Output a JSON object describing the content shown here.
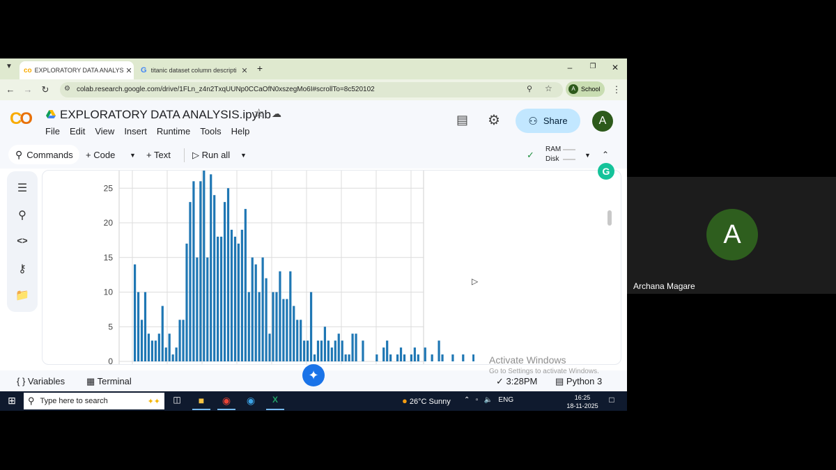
{
  "browser": {
    "tabs": [
      {
        "title": "EXPLORATORY DATA ANALYSIS",
        "icon": "colab-icon",
        "active": true
      },
      {
        "title": "titanic dataset column descripti",
        "icon": "google-icon",
        "active": false
      }
    ],
    "url": "colab.research.google.com/drive/1FLn_z4n2TxqUUNp0CCaOfN0xszegMo6I#scrollTo=8c520102",
    "profile_initial": "A",
    "profile_label": "School"
  },
  "colab": {
    "notebook_title": "EXPLORATORY DATA ANALYSIS.ipynb",
    "menu": [
      "File",
      "Edit",
      "View",
      "Insert",
      "Runtime",
      "Tools",
      "Help"
    ],
    "share_label": "Share",
    "user_initial": "A",
    "toolbar": {
      "commands": "Commands",
      "code": "Code",
      "text": "Text",
      "run_all": "Run all",
      "ram": "RAM",
      "disk": "Disk"
    },
    "status": {
      "variables": "Variables",
      "terminal": "Terminal",
      "time": "3:28PM",
      "kernel": "Python 3"
    }
  },
  "chart_data": {
    "type": "bar",
    "yticks": [
      0,
      5,
      10,
      15,
      20,
      25
    ],
    "ylim": [
      0,
      27
    ],
    "grid": true,
    "values": [
      14,
      10,
      6,
      10,
      4,
      3,
      3,
      4,
      8,
      2,
      4,
      1,
      2,
      6,
      6,
      17,
      23,
      26,
      15,
      26,
      28,
      15,
      27,
      24,
      18,
      18,
      23,
      25,
      19,
      18,
      17,
      19,
      22,
      10,
      15,
      14,
      10,
      15,
      12,
      4,
      10,
      10,
      13,
      9,
      9,
      13,
      8,
      6,
      6,
      3,
      3,
      10,
      1,
      3,
      3,
      5,
      3,
      2,
      3,
      4,
      3,
      1,
      1,
      4,
      4,
      3,
      1,
      2,
      1,
      3,
      1,
      1,
      1,
      1,
      3,
      1,
      1,
      1,
      1,
      1,
      1,
      1,
      1,
      1
    ],
    "bar_slots": [
      0,
      1,
      2,
      3,
      4,
      5,
      6,
      7,
      8,
      9,
      10,
      11,
      12,
      13,
      14,
      15,
      16,
      17,
      18,
      19,
      20,
      21,
      22,
      23,
      24,
      25,
      26,
      27,
      28,
      29,
      30,
      31,
      32,
      33,
      34,
      35,
      36,
      37,
      38,
      39,
      40,
      41,
      42,
      43,
      44,
      45,
      46,
      47,
      48,
      49,
      50,
      51,
      52,
      53,
      54,
      55,
      56,
      57,
      58,
      59,
      60,
      61,
      62,
      63,
      64,
      66,
      70,
      72,
      73,
      74,
      76,
      77,
      78,
      80,
      81,
      82,
      84,
      86,
      88,
      89,
      92,
      95,
      98
    ],
    "visible_values": [
      14,
      10,
      6,
      10,
      4,
      3,
      3,
      4,
      8,
      2,
      4,
      1,
      2,
      6,
      6,
      17,
      23,
      26,
      15,
      26,
      28,
      15,
      27,
      24,
      18,
      18,
      23,
      25,
      19,
      18,
      17,
      19,
      22,
      10,
      15,
      14,
      10,
      15,
      12,
      4,
      10,
      10,
      13,
      9,
      9,
      13,
      8,
      6,
      6,
      3,
      3,
      10,
      1,
      3,
      3,
      5,
      3,
      2,
      3,
      4,
      3,
      1,
      1,
      4,
      4,
      3,
      1,
      2,
      3,
      1,
      1,
      2,
      1,
      1,
      2,
      1,
      2,
      1,
      3,
      1,
      1,
      1,
      1
    ]
  },
  "watermark": {
    "title": "Activate Windows",
    "subtitle": "Go to Settings to activate Windows."
  },
  "taskbar": {
    "search_placeholder": "Type here to search",
    "weather": "26°C  Sunny",
    "language": "ENG",
    "time": "16:25",
    "date": "18-11-2025"
  },
  "participant": {
    "initial": "A",
    "name": "Archana Magare"
  }
}
